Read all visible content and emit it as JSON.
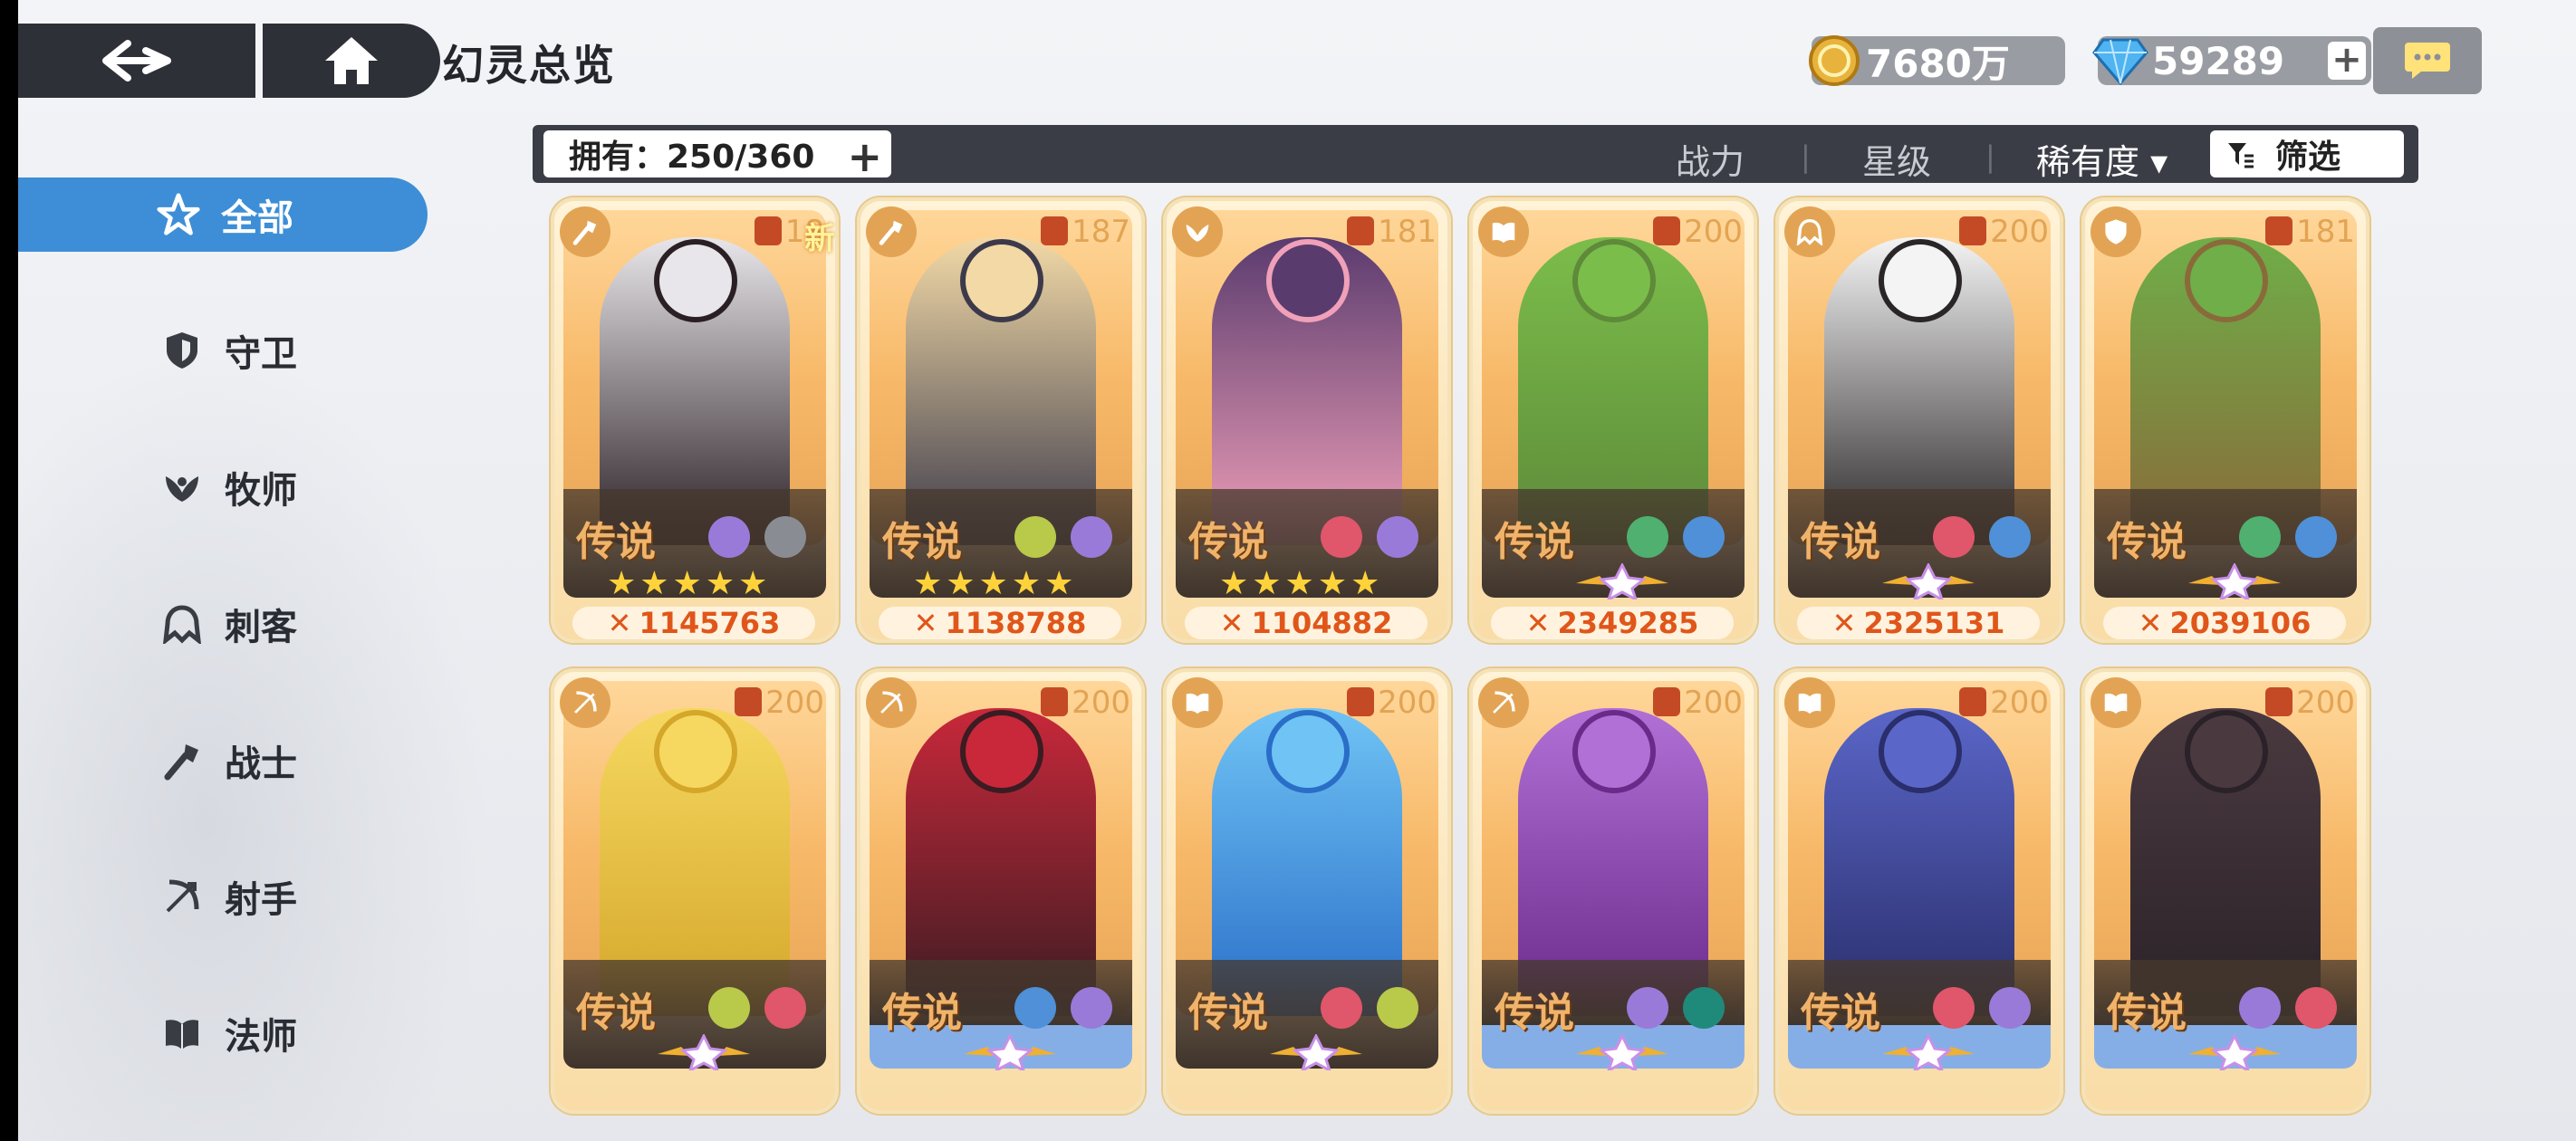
{
  "header": {
    "back_icon": "back-arrow-icon",
    "home_icon": "home-icon",
    "title": "幻灵总览",
    "gold": "7680万",
    "gems": "59289",
    "gem_plus": "+",
    "chat_icon": "chat-bubble-icon"
  },
  "sidebar": {
    "items": [
      {
        "label": "全部",
        "icon": "all-star-icon",
        "active": true
      },
      {
        "label": "守卫",
        "icon": "shield-icon",
        "active": false
      },
      {
        "label": "牧师",
        "icon": "healer-icon",
        "active": false
      },
      {
        "label": "刺客",
        "icon": "assassin-icon",
        "active": false
      },
      {
        "label": "战士",
        "icon": "warrior-icon",
        "active": false
      },
      {
        "label": "射手",
        "icon": "bow-icon",
        "active": false
      },
      {
        "label": "法师",
        "icon": "book-icon",
        "active": false
      }
    ]
  },
  "filterbar": {
    "owned": "拥有：250/360",
    "owned_plus": "+",
    "sort_power": "战力",
    "sort_star": "星级",
    "sort_rarity": "稀有度 ▾",
    "filter_label": "筛选",
    "filter_icon": "filter-icon"
  },
  "cards": [
    {
      "class_icon": "warrior-icon",
      "level": "18",
      "new": "新",
      "rarity": "传说",
      "elements": [
        "purple-gem-icon",
        "white-lotus-icon"
      ],
      "stars": "★★★★★",
      "power": "1145763",
      "bottom": "dark"
    },
    {
      "class_icon": "warrior-icon",
      "level": "187",
      "new": "",
      "rarity": "传说",
      "elements": [
        "leaf-icon",
        "purple-gem-icon"
      ],
      "stars": "★★★★★",
      "power": "1138788",
      "bottom": "dark"
    },
    {
      "class_icon": "healer-icon",
      "level": "181",
      "new": "",
      "rarity": "传说",
      "elements": [
        "swirl-icon",
        "purple-gem-icon"
      ],
      "stars": "★★★★★",
      "power": "1104882",
      "bottom": "dark"
    },
    {
      "class_icon": "book-icon",
      "level": "200",
      "new": "",
      "rarity": "传说",
      "elements": [
        "green-lotus-icon",
        "ice-crystal-icon"
      ],
      "stars": "",
      "power": "2349285",
      "bottom": "dark"
    },
    {
      "class_icon": "assassin-icon",
      "level": "200",
      "new": "",
      "rarity": "传说",
      "elements": [
        "swirl-icon",
        "ice-crystal-icon"
      ],
      "stars": "",
      "power": "2325131",
      "bottom": "dark"
    },
    {
      "class_icon": "shield-icon",
      "level": "181",
      "new": "",
      "rarity": "传说",
      "elements": [
        "green-lotus-icon",
        "ice-crystal-icon"
      ],
      "stars": "",
      "power": "2039106",
      "bottom": "dark"
    },
    {
      "class_icon": "bow-icon",
      "level": "200",
      "new": "",
      "rarity": "传说",
      "elements": [
        "leaf-icon",
        "swirl-icon"
      ],
      "stars": "",
      "power": "",
      "bottom": "dark"
    },
    {
      "class_icon": "bow-icon",
      "level": "200",
      "new": "",
      "rarity": "传说",
      "elements": [
        "ice-crystal-icon",
        "purple-gem-icon"
      ],
      "stars": "",
      "power": "",
      "bottom": "blue"
    },
    {
      "class_icon": "book-icon",
      "level": "200",
      "new": "",
      "rarity": "传说",
      "elements": [
        "swirl-icon",
        "leaf-icon"
      ],
      "stars": "",
      "power": "",
      "bottom": "dark"
    },
    {
      "class_icon": "bow-icon",
      "level": "200",
      "new": "",
      "rarity": "传说",
      "elements": [
        "purple-gem-icon",
        "teal-circle-icon"
      ],
      "stars": "",
      "power": "",
      "bottom": "blue"
    },
    {
      "class_icon": "book-icon",
      "level": "200",
      "new": "",
      "rarity": "传说",
      "elements": [
        "swirl-icon",
        "purple-gem-icon"
      ],
      "stars": "",
      "power": "",
      "bottom": "blue"
    },
    {
      "class_icon": "book-icon",
      "level": "200",
      "new": "",
      "rarity": "传说",
      "elements": [
        "purple-gem-icon",
        "swirl-icon"
      ],
      "stars": "",
      "power": "",
      "bottom": "blue"
    }
  ],
  "colors": {
    "active_tab": "#3d8ed6",
    "power_text": "#e0561a",
    "card_gold": "#f9dca6"
  }
}
